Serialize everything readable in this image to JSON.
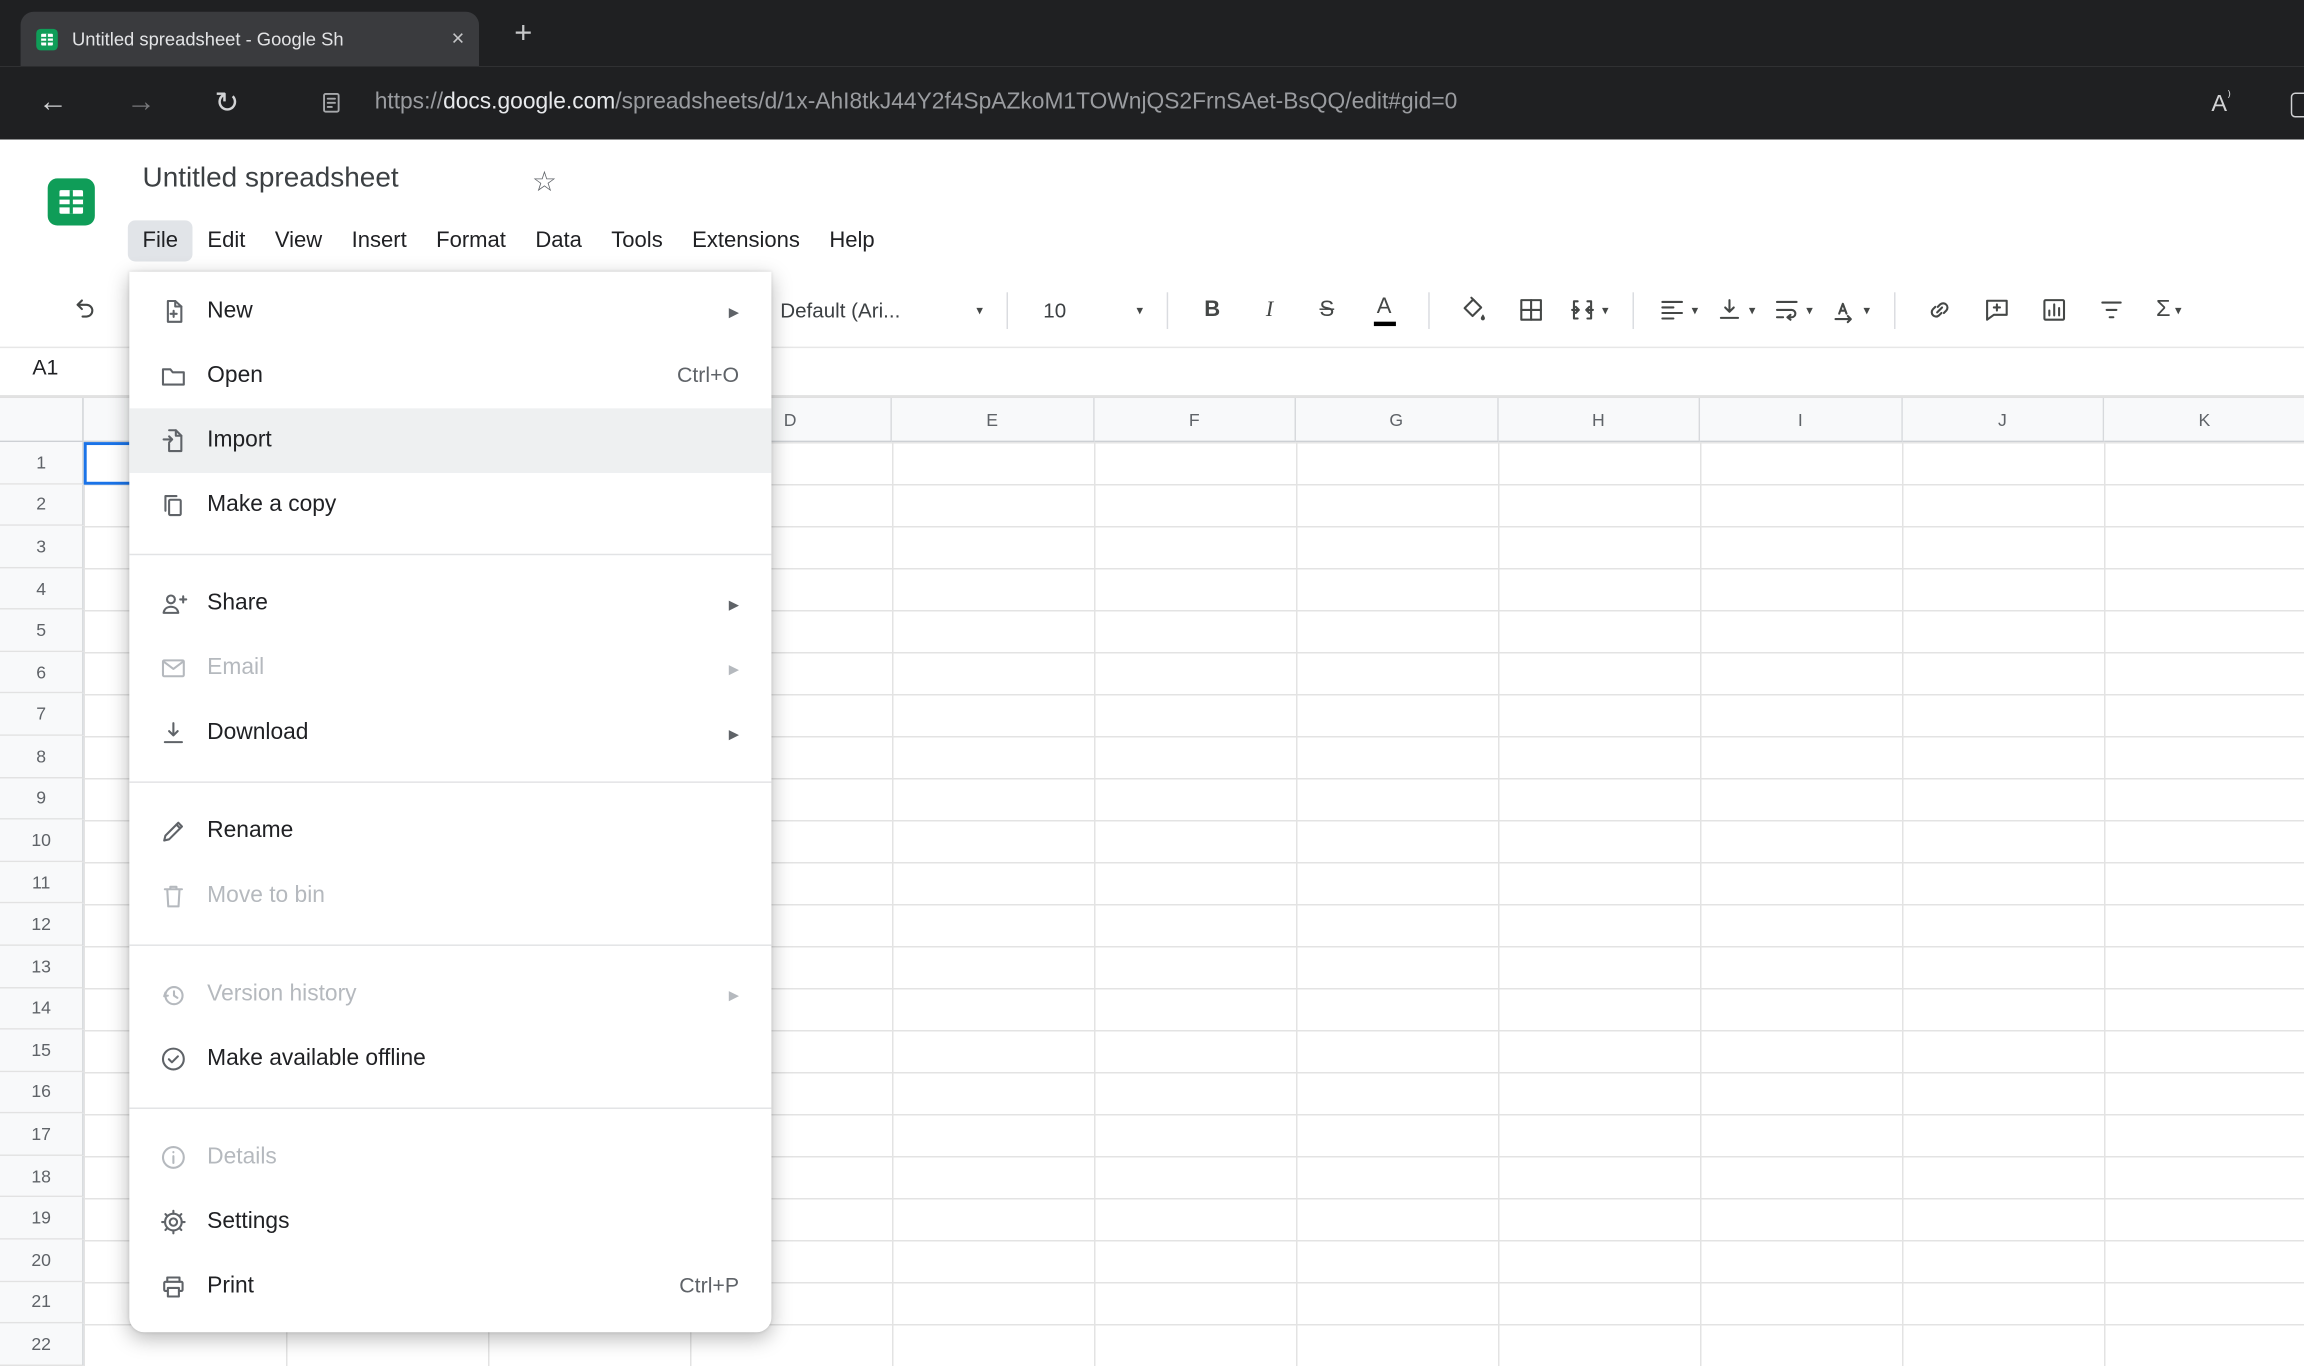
{
  "colors": {
    "sheets_green": "#0f9d58",
    "selection_blue": "#1a73e8",
    "chrome_dark": "#1f2022"
  },
  "browser": {
    "tab_title": "Untitled spreadsheet - Google Sh",
    "url_protocol": "https://",
    "url_domain": "docs.google.com",
    "url_path": "/spreadsheets/d/1x-AhI8tkJ44Y2f4SpAZkoM1TOWnjQS2FrnSAet-BsQQ/edit#gid=0",
    "read_aloud_label": "A"
  },
  "sheets": {
    "title": "Untitled spreadsheet",
    "menubar": {
      "items": [
        "File",
        "Edit",
        "View",
        "Insert",
        "Format",
        "Data",
        "Tools",
        "Extensions",
        "Help"
      ],
      "active_item": "File"
    },
    "toolbar": {
      "controls": [
        {
          "kind": "font",
          "name": "font-family",
          "label": "Default (Ari..."
        },
        {
          "kind": "divider"
        },
        {
          "kind": "size",
          "name": "font-size",
          "label": "10"
        },
        {
          "kind": "divider"
        },
        {
          "kind": "glyph",
          "name": "bold",
          "glyph": "B"
        },
        {
          "kind": "glyph",
          "name": "italic",
          "glyph": "I"
        },
        {
          "kind": "glyph",
          "name": "strikethrough",
          "glyph": "S"
        },
        {
          "kind": "glyph",
          "name": "text-color",
          "glyph": "A",
          "underline": true
        },
        {
          "kind": "divider"
        },
        {
          "kind": "icon",
          "name": "fill-color",
          "icon": "bucket"
        },
        {
          "kind": "icon",
          "name": "borders",
          "icon": "borders"
        },
        {
          "kind": "icon",
          "name": "merge-cells",
          "icon": "merge",
          "dropdown": true
        },
        {
          "kind": "divider"
        },
        {
          "kind": "icon",
          "name": "horizontal-align",
          "icon": "align-left",
          "dropdown": true
        },
        {
          "kind": "icon",
          "name": "vertical-align",
          "icon": "valign",
          "dropdown": true
        },
        {
          "kind": "icon",
          "name": "text-wrap",
          "icon": "wrap",
          "dropdown": true
        },
        {
          "kind": "icon",
          "name": "text-rotation",
          "icon": "rotate",
          "dropdown": true
        },
        {
          "kind": "divider"
        },
        {
          "kind": "icon",
          "name": "insert-link",
          "icon": "link"
        },
        {
          "kind": "icon",
          "name": "insert-comment",
          "icon": "comment"
        },
        {
          "kind": "icon",
          "name": "insert-chart",
          "icon": "chart"
        },
        {
          "kind": "icon",
          "name": "create-filter",
          "icon": "filter"
        },
        {
          "kind": "glyph",
          "name": "functions",
          "glyph": "Σ",
          "dropdown": true
        }
      ]
    },
    "file_menu": {
      "sections": [
        [
          {
            "label": "New",
            "icon": "new-file",
            "submenu": true
          },
          {
            "label": "Open",
            "icon": "folder",
            "shortcut": "Ctrl+O"
          },
          {
            "label": "Import",
            "icon": "import",
            "highlighted": true
          },
          {
            "label": "Make a copy",
            "icon": "copy"
          }
        ],
        [
          {
            "label": "Share",
            "icon": "person-add",
            "submenu": true
          },
          {
            "label": "Email",
            "icon": "envelope",
            "submenu": true,
            "disabled": true
          },
          {
            "label": "Download",
            "icon": "download",
            "submenu": true
          }
        ],
        [
          {
            "label": "Rename",
            "icon": "pencil"
          },
          {
            "label": "Move to bin",
            "icon": "trash",
            "disabled": true
          }
        ],
        [
          {
            "label": "Version history",
            "icon": "history",
            "submenu": true,
            "disabled": true
          },
          {
            "label": "Make available offline",
            "icon": "offline"
          }
        ],
        [
          {
            "label": "Details",
            "icon": "info",
            "disabled": true
          },
          {
            "label": "Settings",
            "icon": "gear"
          },
          {
            "label": "Print",
            "icon": "printer",
            "shortcut": "Ctrl+P"
          }
        ]
      ]
    },
    "grid": {
      "selected_cell": "A1",
      "visible_columns": [
        "D",
        "E",
        "F",
        "G",
        "H",
        "I",
        "J",
        "K"
      ],
      "rows": [
        "1",
        "2",
        "3",
        "4",
        "5",
        "6",
        "7",
        "8",
        "9",
        "10",
        "11",
        "12",
        "13",
        "14",
        "15",
        "16",
        "17",
        "18",
        "19",
        "20",
        "21",
        "22"
      ]
    }
  }
}
